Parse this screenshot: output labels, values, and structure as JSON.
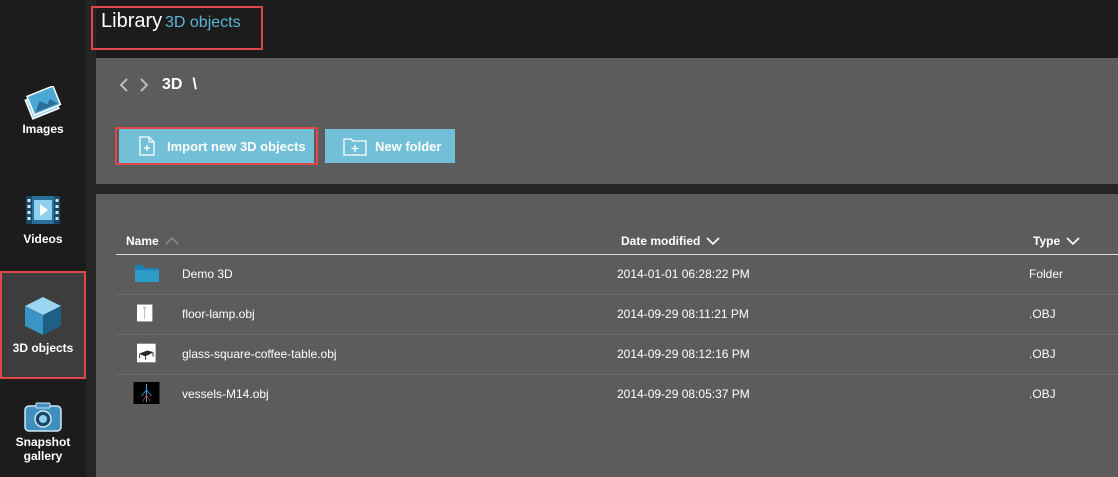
{
  "sidebar": {
    "items": [
      {
        "label": "Images",
        "icon": "images-icon"
      },
      {
        "label": "Videos",
        "icon": "film-icon"
      },
      {
        "label": "3D objects",
        "icon": "cube-icon"
      },
      {
        "label_line1": "Snapshot",
        "label_line2": "gallery",
        "icon": "camera-icon"
      }
    ]
  },
  "header": {
    "title": "Library",
    "subtitle": "3D objects"
  },
  "toolbar": {
    "crumb": "3D",
    "crumb_separator": "\\",
    "import_label": "Import new 3D objects",
    "new_folder_label": "New folder"
  },
  "table": {
    "columns": {
      "name": "Name",
      "date": "Date modified",
      "type": "Type"
    },
    "rows": [
      {
        "name": "Demo 3D",
        "date": "2014-01-01 06:28:22 PM",
        "type": "Folder",
        "thumb": "folder-icon"
      },
      {
        "name": "floor-lamp.obj",
        "date": "2014-09-29 08:11:21 PM",
        "type": ".OBJ",
        "thumb": "floor-lamp-thumbnail"
      },
      {
        "name": "glass-square-coffee-table.obj",
        "date": "2014-09-29 08:12:16 PM",
        "type": ".OBJ",
        "thumb": "coffee-table-thumbnail"
      },
      {
        "name": "vessels-M14.obj",
        "date": "2014-09-29 08:05:37 PM",
        "type": ".OBJ",
        "thumb": "vessels-thumbnail"
      }
    ]
  },
  "colors": {
    "accent": "#72bfd8",
    "highlight": "#e04848",
    "panel": "#5c5c5c",
    "background": "#1c1c1c"
  }
}
